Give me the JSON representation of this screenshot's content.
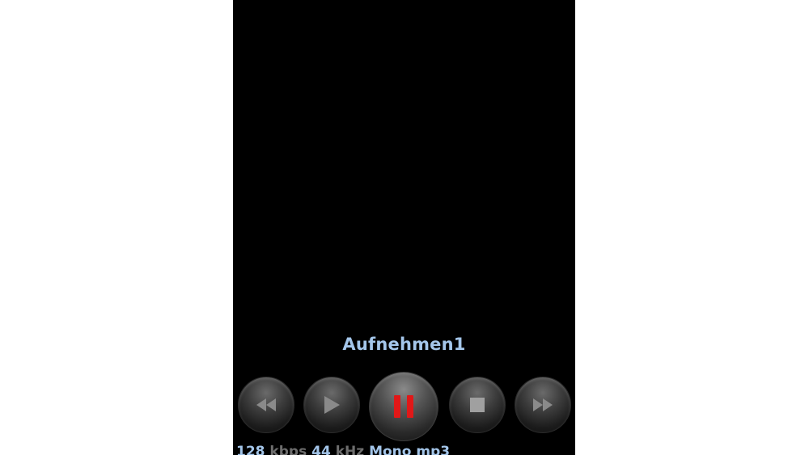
{
  "player": {
    "track_title": "Aufnehmen1",
    "controls": {
      "rewind": "rewind-icon",
      "play": "play-icon",
      "pause": "pause-icon",
      "stop": "stop-icon",
      "fast_forward": "fast-forward-icon"
    },
    "info": {
      "bitrate_value": "128",
      "bitrate_unit": "kbps",
      "samplerate_value": "44",
      "samplerate_unit": "kHz",
      "channels": "Mono",
      "format": "mp3"
    }
  },
  "colors": {
    "background": "#000000",
    "title_text": "#a4c6ea",
    "unit_text": "#6e6e6e",
    "pause_accent": "#e01818"
  }
}
